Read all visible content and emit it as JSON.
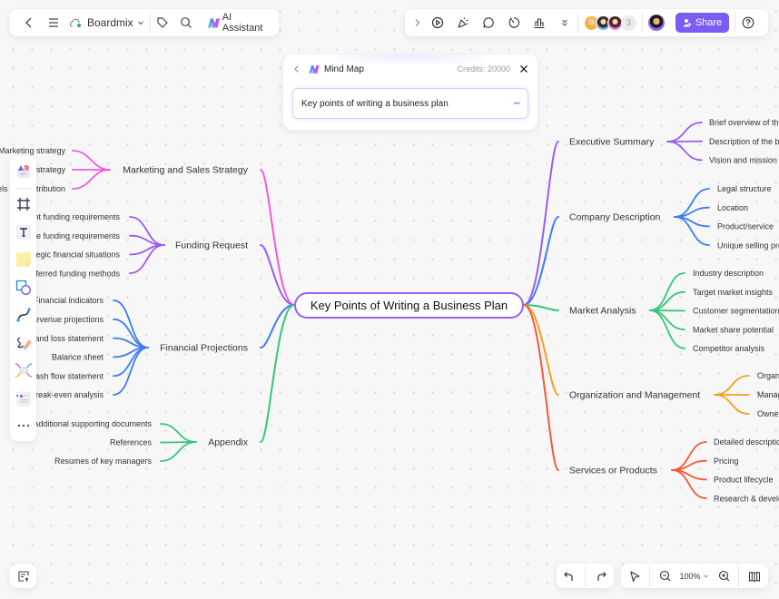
{
  "topbar_left": {
    "back_icon": "chevron-left-icon",
    "menu_icon": "hamburger-icon",
    "brand": "Boardmix",
    "tag_icon": "tag-icon",
    "search_icon": "search-icon",
    "ai_label": "AI Assistant"
  },
  "topbar_right": {
    "collaborator_count": "3",
    "share_label": "Share"
  },
  "dialog": {
    "title": "Mind Map",
    "credits": "Credits: 20000",
    "prompt": "Key points of writing a business plan",
    "dots": "•••"
  },
  "zoom": {
    "level": "100%"
  },
  "colors": {
    "accent": "#7a5cf5",
    "center_border": "#9a5ff2",
    "pink": "#f25ad7",
    "purple": "#9b5cf3",
    "blue": "#3f7bf5",
    "green": "#33c777",
    "orange": "#f59f1f",
    "red": "#f5583b"
  },
  "mindmap": {
    "center": "Key Points of Writing a Business Plan",
    "left": [
      {
        "label": "Marketing and Sales Strategy",
        "color": "pink",
        "children": [
          "Marketing strategy",
          "Sales strategy",
          "Channels and distribution"
        ]
      },
      {
        "label": "Funding Request",
        "color": "purple",
        "children": [
          "Current funding requirements",
          "Future funding requirements",
          "Strategic financial situations",
          "Preferred funding methods"
        ]
      },
      {
        "label": "Financial Projections",
        "color": "blue",
        "children": [
          "Financial indicators",
          "Revenue projections",
          "Profit and loss statement",
          "Balance sheet",
          "Cash flow statement",
          "Break-even analysis"
        ]
      },
      {
        "label": "Appendix",
        "color": "green",
        "children": [
          "Additional supporting documents",
          "References",
          "Resumes of key managers"
        ]
      }
    ],
    "right": [
      {
        "label": "Executive Summary",
        "color": "purple",
        "children": [
          "Brief overview of the business",
          "Description of the business",
          "Vision and mission statement"
        ]
      },
      {
        "label": "Company Description",
        "color": "blue",
        "children": [
          "Legal structure",
          "Location",
          "Product/service",
          "Unique selling proposition"
        ]
      },
      {
        "label": "Market Analysis",
        "color": "green",
        "children": [
          "Industry description",
          "Target market insights",
          "Customer segmentation",
          "Market share potential",
          "Competitor analysis"
        ]
      },
      {
        "label": "Organization and Management",
        "color": "orange",
        "children": [
          "Organizational structure",
          "Management team",
          "Ownership"
        ]
      },
      {
        "label": "Services or Products",
        "color": "red",
        "children": [
          "Detailed description",
          "Pricing",
          "Product lifecycle",
          "Research & development"
        ]
      }
    ]
  }
}
